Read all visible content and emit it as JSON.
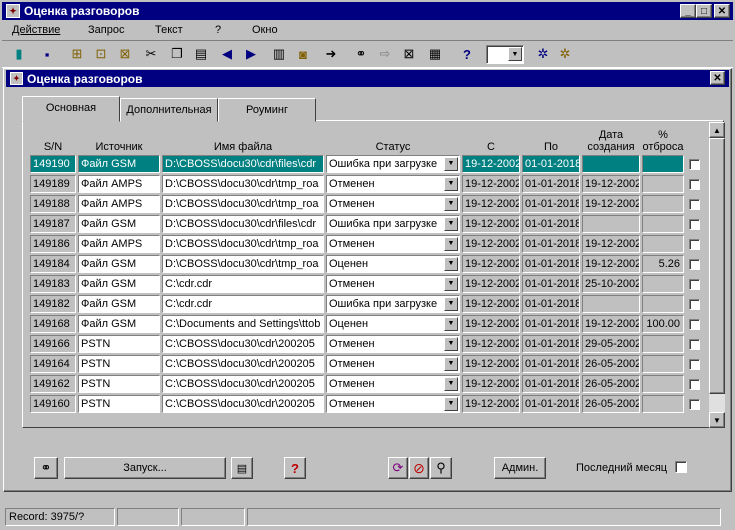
{
  "app": {
    "title": "Оценка разговоров"
  },
  "menu": [
    "Действие",
    "Запрос",
    "Текст",
    "?",
    "Окно"
  ],
  "window": {
    "title": "Оценка разговоров"
  },
  "tabs": [
    "Основная",
    "Дополнительная",
    "Роуминг"
  ],
  "columns": {
    "sn": "S/N",
    "source": "Источник",
    "file": "Имя файла",
    "status": "Статус",
    "from": "С",
    "to": "По",
    "created_1": "Дата",
    "created_2": "создания",
    "drop_1": "%",
    "drop_2": "отброса"
  },
  "rows": [
    {
      "sn": "149190",
      "source": "Файл GSM",
      "file": "D:\\CBOSS\\docu30\\cdr\\files\\cdr",
      "status": "Ошибка при загрузке",
      "from": "19-12-2002",
      "to": "01-01-2018",
      "created": "",
      "drop": "",
      "selected": true
    },
    {
      "sn": "149189",
      "source": "Файл AMPS",
      "file": "D:\\CBOSS\\docu30\\cdr\\tmp_roa",
      "status": "Отменен",
      "from": "19-12-2002",
      "to": "01-01-2018",
      "created": "19-12-2002",
      "drop": ""
    },
    {
      "sn": "149188",
      "source": "Файл AMPS",
      "file": "D:\\CBOSS\\docu30\\cdr\\tmp_roa",
      "status": "Отменен",
      "from": "19-12-2002",
      "to": "01-01-2018",
      "created": "19-12-2002",
      "drop": ""
    },
    {
      "sn": "149187",
      "source": "Файл GSM",
      "file": "D:\\CBOSS\\docu30\\cdr\\files\\cdr",
      "status": "Ошибка при загрузке",
      "from": "19-12-2002",
      "to": "01-01-2018",
      "created": "",
      "drop": ""
    },
    {
      "sn": "149186",
      "source": "Файл AMPS",
      "file": "D:\\CBOSS\\docu30\\cdr\\tmp_roa",
      "status": "Отменен",
      "from": "19-12-2002",
      "to": "01-01-2018",
      "created": "19-12-2002",
      "drop": ""
    },
    {
      "sn": "149184",
      "source": "Файл GSM",
      "file": "D:\\CBOSS\\docu30\\cdr\\tmp_roa",
      "status": "Оценен",
      "from": "19-12-2002",
      "to": "01-01-2018",
      "created": "19-12-2002",
      "drop": "5.26"
    },
    {
      "sn": "149183",
      "source": "Файл GSM",
      "file": "C:\\cdr.cdr",
      "status": "Отменен",
      "from": "19-12-2002",
      "to": "01-01-2018",
      "created": "25-10-2002",
      "drop": ""
    },
    {
      "sn": "149182",
      "source": "Файл GSM",
      "file": "C:\\cdr.cdr",
      "status": "Ошибка при загрузке",
      "from": "19-12-2002",
      "to": "01-01-2018",
      "created": "",
      "drop": ""
    },
    {
      "sn": "149168",
      "source": "Файл GSM",
      "file": "C:\\Documents and Settings\\ttob",
      "status": "Оценен",
      "from": "19-12-2002",
      "to": "01-01-2018",
      "created": "19-12-2002",
      "drop": "100.00"
    },
    {
      "sn": "149166",
      "source": "PSTN",
      "file": "C:\\CBOSS\\docu30\\cdr\\200205",
      "status": "Отменен",
      "from": "19-12-2002",
      "to": "01-01-2018",
      "created": "29-05-2002",
      "drop": ""
    },
    {
      "sn": "149164",
      "source": "PSTN",
      "file": "C:\\CBOSS\\docu30\\cdr\\200205",
      "status": "Отменен",
      "from": "19-12-2002",
      "to": "01-01-2018",
      "created": "26-05-2002",
      "drop": ""
    },
    {
      "sn": "149162",
      "source": "PSTN",
      "file": "C:\\CBOSS\\docu30\\cdr\\200205",
      "status": "Отменен",
      "from": "19-12-2002",
      "to": "01-01-2018",
      "created": "26-05-2002",
      "drop": ""
    },
    {
      "sn": "149160",
      "source": "PSTN",
      "file": "C:\\CBOSS\\docu30\\cdr\\200205",
      "status": "Отменен",
      "from": "19-12-2002",
      "to": "01-01-2018",
      "created": "26-05-2002",
      "drop": ""
    }
  ],
  "buttons": {
    "run": "Запуск...",
    "admin": "Админ."
  },
  "last_month": {
    "label": "Последний месяц",
    "checked": false
  },
  "status_bar": {
    "record": "Record: 3975/?"
  },
  "icons": [
    "door-exit-icon",
    "save-icon",
    "copy-db-icon",
    "query-icon",
    "delete-db-icon",
    "cut-icon",
    "copy-icon",
    "paste-icon",
    "prev-icon",
    "next-icon",
    "clipboard-icon",
    "trash-icon",
    "goto-icon",
    "binoculars-icon",
    "arrow-icon",
    "close-form-icon",
    "report-icon",
    "help-icon",
    "gear-icon",
    "gear2-icon"
  ],
  "colors": {
    "title": "#000080",
    "selection": "#008080",
    "face": "#c0c0c0"
  }
}
